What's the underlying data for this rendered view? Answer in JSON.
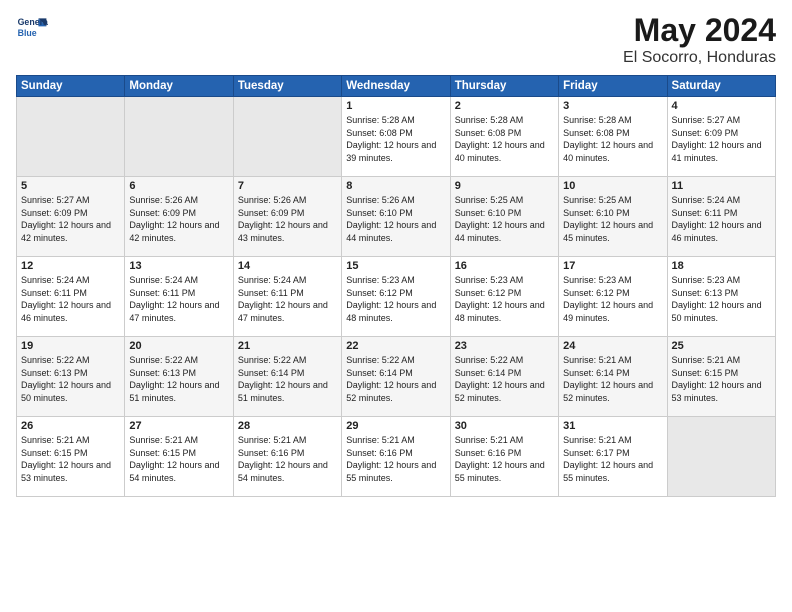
{
  "logo": {
    "line1": "General",
    "line2": "Blue"
  },
  "header": {
    "month": "May 2024",
    "location": "El Socorro, Honduras"
  },
  "weekdays": [
    "Sunday",
    "Monday",
    "Tuesday",
    "Wednesday",
    "Thursday",
    "Friday",
    "Saturday"
  ],
  "weeks": [
    [
      {
        "day": "",
        "empty": true
      },
      {
        "day": "",
        "empty": true
      },
      {
        "day": "",
        "empty": true
      },
      {
        "day": "1",
        "sunrise": "5:28 AM",
        "sunset": "6:08 PM",
        "daylight": "12 hours and 39 minutes."
      },
      {
        "day": "2",
        "sunrise": "5:28 AM",
        "sunset": "6:08 PM",
        "daylight": "12 hours and 40 minutes."
      },
      {
        "day": "3",
        "sunrise": "5:28 AM",
        "sunset": "6:08 PM",
        "daylight": "12 hours and 40 minutes."
      },
      {
        "day": "4",
        "sunrise": "5:27 AM",
        "sunset": "6:09 PM",
        "daylight": "12 hours and 41 minutes."
      }
    ],
    [
      {
        "day": "5",
        "sunrise": "5:27 AM",
        "sunset": "6:09 PM",
        "daylight": "12 hours and 42 minutes."
      },
      {
        "day": "6",
        "sunrise": "5:26 AM",
        "sunset": "6:09 PM",
        "daylight": "12 hours and 42 minutes."
      },
      {
        "day": "7",
        "sunrise": "5:26 AM",
        "sunset": "6:09 PM",
        "daylight": "12 hours and 43 minutes."
      },
      {
        "day": "8",
        "sunrise": "5:26 AM",
        "sunset": "6:10 PM",
        "daylight": "12 hours and 44 minutes."
      },
      {
        "day": "9",
        "sunrise": "5:25 AM",
        "sunset": "6:10 PM",
        "daylight": "12 hours and 44 minutes."
      },
      {
        "day": "10",
        "sunrise": "5:25 AM",
        "sunset": "6:10 PM",
        "daylight": "12 hours and 45 minutes."
      },
      {
        "day": "11",
        "sunrise": "5:24 AM",
        "sunset": "6:11 PM",
        "daylight": "12 hours and 46 minutes."
      }
    ],
    [
      {
        "day": "12",
        "sunrise": "5:24 AM",
        "sunset": "6:11 PM",
        "daylight": "12 hours and 46 minutes."
      },
      {
        "day": "13",
        "sunrise": "5:24 AM",
        "sunset": "6:11 PM",
        "daylight": "12 hours and 47 minutes."
      },
      {
        "day": "14",
        "sunrise": "5:24 AM",
        "sunset": "6:11 PM",
        "daylight": "12 hours and 47 minutes."
      },
      {
        "day": "15",
        "sunrise": "5:23 AM",
        "sunset": "6:12 PM",
        "daylight": "12 hours and 48 minutes."
      },
      {
        "day": "16",
        "sunrise": "5:23 AM",
        "sunset": "6:12 PM",
        "daylight": "12 hours and 48 minutes."
      },
      {
        "day": "17",
        "sunrise": "5:23 AM",
        "sunset": "6:12 PM",
        "daylight": "12 hours and 49 minutes."
      },
      {
        "day": "18",
        "sunrise": "5:23 AM",
        "sunset": "6:13 PM",
        "daylight": "12 hours and 50 minutes."
      }
    ],
    [
      {
        "day": "19",
        "sunrise": "5:22 AM",
        "sunset": "6:13 PM",
        "daylight": "12 hours and 50 minutes."
      },
      {
        "day": "20",
        "sunrise": "5:22 AM",
        "sunset": "6:13 PM",
        "daylight": "12 hours and 51 minutes."
      },
      {
        "day": "21",
        "sunrise": "5:22 AM",
        "sunset": "6:14 PM",
        "daylight": "12 hours and 51 minutes."
      },
      {
        "day": "22",
        "sunrise": "5:22 AM",
        "sunset": "6:14 PM",
        "daylight": "12 hours and 52 minutes."
      },
      {
        "day": "23",
        "sunrise": "5:22 AM",
        "sunset": "6:14 PM",
        "daylight": "12 hours and 52 minutes."
      },
      {
        "day": "24",
        "sunrise": "5:21 AM",
        "sunset": "6:14 PM",
        "daylight": "12 hours and 52 minutes."
      },
      {
        "day": "25",
        "sunrise": "5:21 AM",
        "sunset": "6:15 PM",
        "daylight": "12 hours and 53 minutes."
      }
    ],
    [
      {
        "day": "26",
        "sunrise": "5:21 AM",
        "sunset": "6:15 PM",
        "daylight": "12 hours and 53 minutes."
      },
      {
        "day": "27",
        "sunrise": "5:21 AM",
        "sunset": "6:15 PM",
        "daylight": "12 hours and 54 minutes."
      },
      {
        "day": "28",
        "sunrise": "5:21 AM",
        "sunset": "6:16 PM",
        "daylight": "12 hours and 54 minutes."
      },
      {
        "day": "29",
        "sunrise": "5:21 AM",
        "sunset": "6:16 PM",
        "daylight": "12 hours and 55 minutes."
      },
      {
        "day": "30",
        "sunrise": "5:21 AM",
        "sunset": "6:16 PM",
        "daylight": "12 hours and 55 minutes."
      },
      {
        "day": "31",
        "sunrise": "5:21 AM",
        "sunset": "6:17 PM",
        "daylight": "12 hours and 55 minutes."
      },
      {
        "day": "",
        "empty": true
      }
    ]
  ]
}
